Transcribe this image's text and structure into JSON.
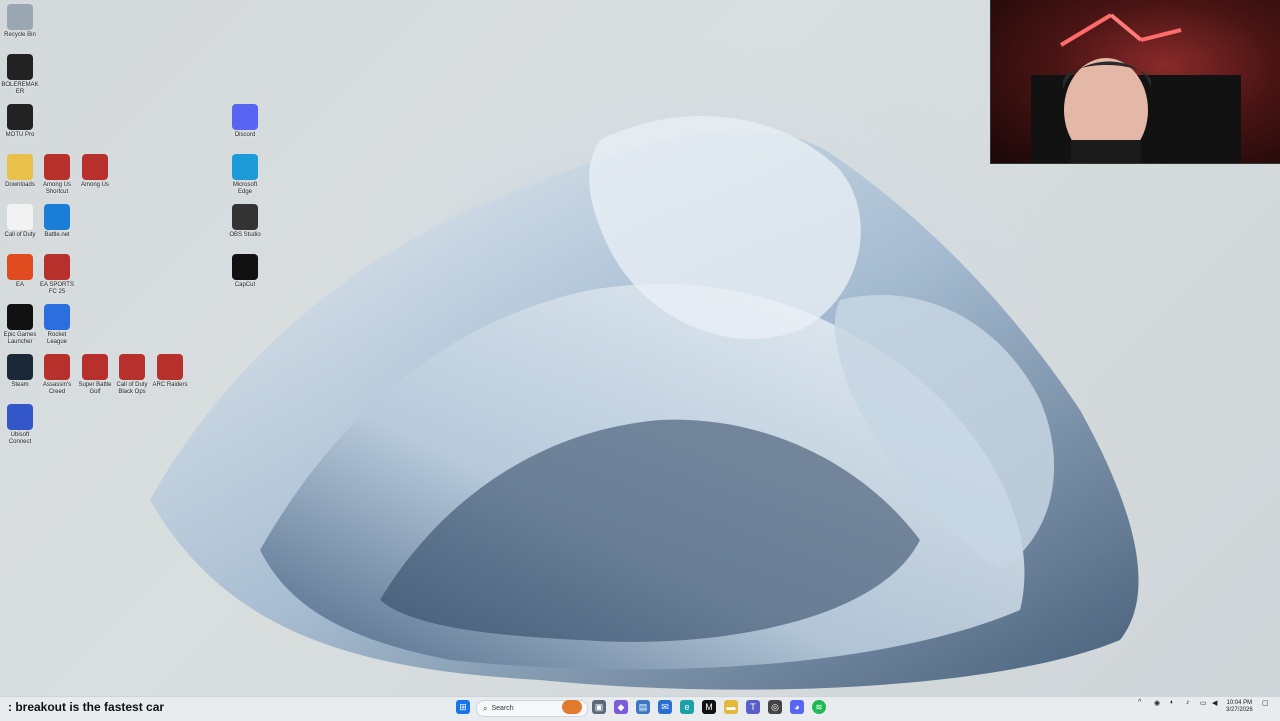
{
  "desktop": {
    "icons": [
      {
        "label": "Recycle Bin",
        "icon": "recycle-bin-icon"
      },
      {
        "label": "BOLEREMAKER",
        "icon": "app-icon"
      },
      {
        "label": "MOTU Pro",
        "icon": "app-icon"
      },
      {
        "label": "Downloads",
        "icon": "folder-icon"
      },
      {
        "label": "Among Us Shortcut",
        "icon": "game-icon"
      },
      {
        "label": "Among Us",
        "icon": "game-icon"
      },
      {
        "label": "Call of Duty",
        "icon": "file-icon"
      },
      {
        "label": "Battle.net",
        "icon": "battlenet-icon"
      },
      {
        "label": "EA",
        "icon": "ea-icon"
      },
      {
        "label": "EA SPORTS FC 25",
        "icon": "game-icon"
      },
      {
        "label": "Epic Games Launcher",
        "icon": "epic-icon"
      },
      {
        "label": "Rocket League",
        "icon": "rocket-league-icon"
      },
      {
        "label": "Steam",
        "icon": "steam-icon"
      },
      {
        "label": "Assassin's Creed",
        "icon": "game-icon"
      },
      {
        "label": "Super Battle Golf",
        "icon": "game-icon"
      },
      {
        "label": "Call of Duty Black Ops",
        "icon": "game-icon"
      },
      {
        "label": "ARC Raiders",
        "icon": "game-icon"
      },
      {
        "label": "Ubisoft Connect",
        "icon": "ubisoft-icon"
      },
      {
        "label": "Discord",
        "icon": "discord-icon"
      },
      {
        "label": "Microsoft Edge",
        "icon": "edge-icon"
      },
      {
        "label": "OBS Studio",
        "icon": "obs-icon"
      },
      {
        "label": "CapCut",
        "icon": "capcut-icon"
      }
    ]
  },
  "stream": {
    "caption_user": "",
    "caption_text": ": breakout is the fastest car"
  },
  "taskbar": {
    "search_label": "Search",
    "clock_time": "10:04 PM",
    "clock_date": "3/27/2026"
  }
}
